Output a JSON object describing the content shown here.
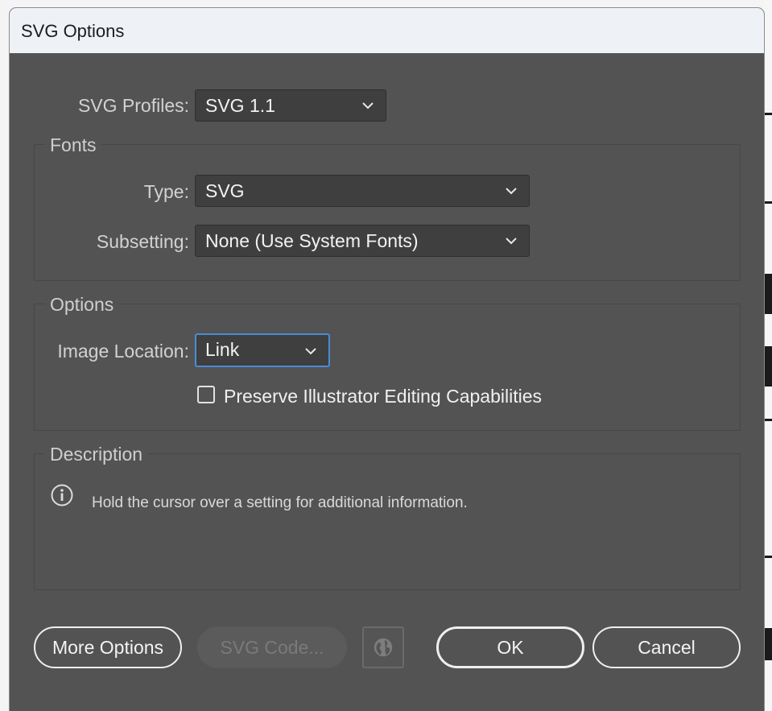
{
  "dialog": {
    "title": "SVG Options"
  },
  "profiles": {
    "label": "SVG Profiles:",
    "value": "SVG 1.1"
  },
  "fonts": {
    "group_title": "Fonts",
    "type_label": "Type:",
    "type_value": "SVG",
    "subsetting_label": "Subsetting:",
    "subsetting_value": "None (Use System Fonts)"
  },
  "options": {
    "group_title": "Options",
    "image_location_label": "Image Location:",
    "image_location_value": "Link",
    "preserve_label": "Preserve Illustrator Editing Capabilities",
    "preserve_checked": false
  },
  "description": {
    "group_title": "Description",
    "text": "Hold the cursor over a setting for additional information."
  },
  "buttons": {
    "more_options": "More Options",
    "svg_code": "SVG Code...",
    "ok": "OK",
    "cancel": "Cancel"
  },
  "icons": {
    "dropdown": "chevron-down-icon",
    "info": "info-icon",
    "web": "globe-icon"
  },
  "colors": {
    "dialog_bg": "#535353",
    "focus_border": "#4a8cd6",
    "titlebar_bg": "#eef2f7"
  }
}
